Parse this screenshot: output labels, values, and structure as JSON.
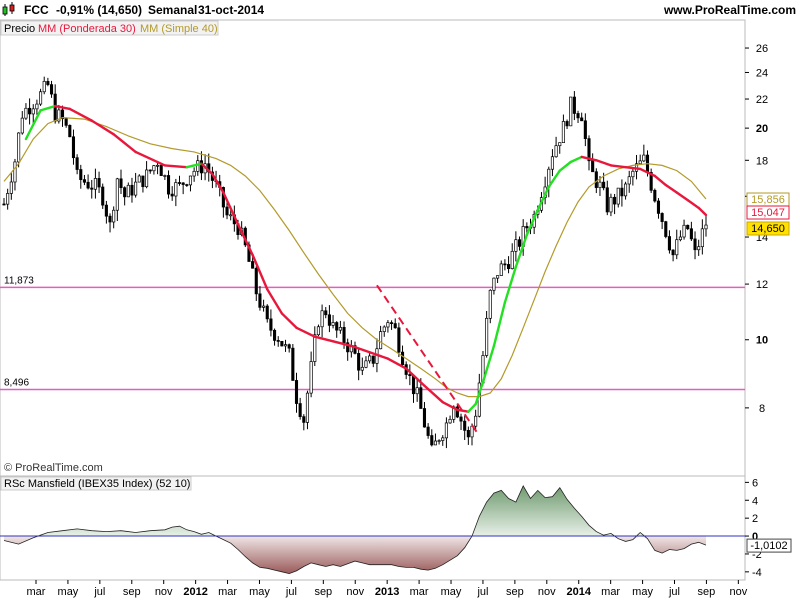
{
  "header": {
    "symbol": "FCC",
    "change": "-0,91% (14,650)",
    "period": "Semanal",
    "date": "31-oct-2014",
    "site": "www.ProRealTime.com"
  },
  "legend": {
    "price": "Precio",
    "wma": "MM (Ponderada 30)",
    "sma": "MM (Simple 40)"
  },
  "copyright": "© ProRealTime.com",
  "colors": {
    "wma": "#e8173c",
    "sma": "#b39a2a",
    "green": "#22e022",
    "hline": "#e060c0",
    "trend": "#e8173c",
    "area_pos": "#8ab08a",
    "area_neg": "#b07070",
    "baseline": "#3030c0",
    "candle": "#000000"
  },
  "chart_data": [
    {
      "type": "candlestick",
      "title": "FCC Semanal",
      "ylim": [
        6.4,
        28.5
      ],
      "y_scale": "log",
      "y_ticks": [
        8,
        10,
        12,
        14,
        16,
        18,
        20,
        22,
        24,
        26
      ],
      "x_ticks": [
        "mar",
        "may",
        "jul",
        "sep",
        "nov",
        "2012",
        "mar",
        "may",
        "jul",
        "sep",
        "nov",
        "2013",
        "mar",
        "may",
        "jul",
        "sep",
        "nov",
        "2014",
        "mar",
        "may",
        "jul",
        "sep",
        "nov"
      ],
      "close_path": [
        [
          0,
          15.6
        ],
        [
          3,
          18
        ],
        [
          5,
          21
        ],
        [
          8,
          21.8
        ],
        [
          10,
          22.3
        ],
        [
          12,
          23
        ],
        [
          14,
          21
        ],
        [
          16,
          20.5
        ],
        [
          18,
          19.5
        ],
        [
          20,
          17
        ],
        [
          22,
          16.8
        ],
        [
          25,
          16.5
        ],
        [
          27,
          16
        ],
        [
          29,
          14.5
        ],
        [
          31,
          17
        ],
        [
          33,
          16
        ],
        [
          36,
          16.6
        ],
        [
          39,
          17.1
        ],
        [
          42,
          18
        ],
        [
          45,
          16.5
        ],
        [
          48,
          16.5
        ],
        [
          51,
          17.3
        ],
        [
          55,
          17.8
        ],
        [
          58,
          16.5
        ],
        [
          61,
          15
        ],
        [
          64,
          14.5
        ],
        [
          66,
          13.5
        ],
        [
          69,
          11.7
        ],
        [
          72,
          10.5
        ],
        [
          75,
          10.1
        ],
        [
          78,
          9.5
        ],
        [
          80,
          8.3
        ],
        [
          82,
          7.7
        ],
        [
          84,
          9.1
        ],
        [
          86,
          10.7
        ],
        [
          88,
          11
        ],
        [
          90,
          10.4
        ],
        [
          93,
          10
        ],
        [
          96,
          9.5
        ],
        [
          98,
          9
        ],
        [
          101,
          9.4
        ],
        [
          103,
          10.2
        ],
        [
          105,
          10.7
        ],
        [
          107,
          10.3
        ],
        [
          109,
          9.5
        ],
        [
          111,
          8.8
        ],
        [
          113,
          8.3
        ],
        [
          115,
          7.6
        ],
        [
          117,
          6.9
        ],
        [
          119,
          7.3
        ],
        [
          121,
          7.6
        ],
        [
          123,
          8.2
        ],
        [
          125,
          7.7
        ],
        [
          127,
          7.2
        ],
        [
          129,
          7.9
        ],
        [
          131,
          9.5
        ],
        [
          133,
          11.6
        ],
        [
          135,
          12.5
        ],
        [
          137,
          12.8
        ],
        [
          139,
          13.2
        ],
        [
          141,
          13.8
        ],
        [
          143,
          14.5
        ],
        [
          145,
          15
        ],
        [
          148,
          17
        ],
        [
          150,
          18.5
        ],
        [
          153,
          20
        ],
        [
          155,
          21.5
        ],
        [
          158,
          21
        ],
        [
          160,
          17.5
        ],
        [
          163,
          16.5
        ],
        [
          165,
          15.5
        ],
        [
          168,
          16
        ],
        [
          170,
          16.4
        ],
        [
          172,
          17.3
        ],
        [
          175,
          18
        ],
        [
          178,
          16
        ],
        [
          181,
          14.3
        ],
        [
          183,
          13.2
        ],
        [
          185,
          14
        ],
        [
          187,
          14.4
        ],
        [
          189,
          13.2
        ],
        [
          192,
          14.65
        ]
      ],
      "series": [
        {
          "name": "MM (Ponderada 30)",
          "last": 15.047,
          "points": [
            [
              6,
              19.3
            ],
            [
              10,
              21.2
            ],
            [
              14,
              21.5
            ],
            [
              18,
              21.3
            ],
            [
              24,
              20.5
            ],
            [
              30,
              19.6
            ],
            [
              36,
              18.5
            ],
            [
              44,
              17.7
            ],
            [
              50,
              17.6
            ],
            [
              54,
              17.8
            ],
            [
              57,
              17.2
            ],
            [
              60,
              16.2
            ],
            [
              64,
              14.6
            ],
            [
              68,
              13.2
            ],
            [
              72,
              11.8
            ],
            [
              76,
              10.9
            ],
            [
              80,
              10.4
            ],
            [
              85,
              10.1
            ],
            [
              90,
              9.95
            ],
            [
              95,
              9.8
            ],
            [
              100,
              9.6
            ],
            [
              105,
              9.4
            ],
            [
              110,
              9.1
            ],
            [
              115,
              8.6
            ],
            [
              120,
              8.15
            ],
            [
              124,
              7.95
            ],
            [
              127,
              7.9
            ],
            [
              129,
              8.1
            ],
            [
              131,
              8.7
            ],
            [
              134,
              9.8
            ],
            [
              137,
              11.3
            ],
            [
              140,
              12.7
            ],
            [
              143,
              14.1
            ],
            [
              146,
              15.3
            ],
            [
              149,
              16.5
            ],
            [
              152,
              17.4
            ],
            [
              155,
              17.9
            ],
            [
              158,
              18.2
            ],
            [
              162,
              18
            ],
            [
              166,
              17.7
            ],
            [
              170,
              17.6
            ],
            [
              174,
              17.5
            ],
            [
              178,
              17.1
            ],
            [
              181,
              16.6
            ],
            [
              184,
              16.2
            ],
            [
              187,
              15.8
            ],
            [
              190,
              15.4
            ],
            [
              192,
              15.047
            ]
          ]
        },
        {
          "name": "MM (Simple 40)",
          "last": 15.856,
          "points": [
            [
              0,
              16.8
            ],
            [
              4,
              17.8
            ],
            [
              8,
              19.3
            ],
            [
              12,
              20.3
            ],
            [
              16,
              20.7
            ],
            [
              22,
              20.6
            ],
            [
              28,
              20.1
            ],
            [
              34,
              19.5
            ],
            [
              40,
              19
            ],
            [
              46,
              18.7
            ],
            [
              52,
              18.5
            ],
            [
              58,
              18.1
            ],
            [
              62,
              17.7
            ],
            [
              66,
              17.1
            ],
            [
              70,
              16.3
            ],
            [
              74,
              15.3
            ],
            [
              78,
              14.3
            ],
            [
              82,
              13.3
            ],
            [
              86,
              12.4
            ],
            [
              90,
              11.6
            ],
            [
              94,
              10.9
            ],
            [
              98,
              10.4
            ],
            [
              102,
              10
            ],
            [
              106,
              9.7
            ],
            [
              110,
              9.4
            ],
            [
              114,
              9.1
            ],
            [
              118,
              8.8
            ],
            [
              121,
              8.55
            ],
            [
              124,
              8.4
            ],
            [
              127,
              8.3
            ],
            [
              130,
              8.3
            ],
            [
              133,
              8.4
            ],
            [
              136,
              8.8
            ],
            [
              139,
              9.5
            ],
            [
              142,
              10.4
            ],
            [
              145,
              11.4
            ],
            [
              148,
              12.5
            ],
            [
              151,
              13.6
            ],
            [
              154,
              14.7
            ],
            [
              157,
              15.7
            ],
            [
              160,
              16.5
            ],
            [
              164,
              17.1
            ],
            [
              168,
              17.5
            ],
            [
              172,
              17.7
            ],
            [
              176,
              17.8
            ],
            [
              180,
              17.7
            ],
            [
              184,
              17.4
            ],
            [
              188,
              16.8
            ],
            [
              192,
              15.856
            ]
          ]
        }
      ],
      "horizontal_lines": [
        {
          "value": 11.873,
          "label": "11,873"
        },
        {
          "value": 8.496,
          "label": "8,496"
        }
      ],
      "trendline": [
        [
          102,
          11.95
        ],
        [
          130,
          7.3
        ]
      ],
      "last_labels": [
        "15,856",
        "15,047",
        "14,650"
      ]
    },
    {
      "type": "area",
      "title": "RSc Mansfield (IBEX35 Index) (52 10)",
      "ylim": [
        -4.8,
        6.6
      ],
      "y_ticks": [
        6,
        4,
        2,
        0,
        -2,
        -4
      ],
      "last_value": -1.0102,
      "last_label": "-1,0102",
      "points": [
        [
          0,
          -0.5
        ],
        [
          4,
          -0.9
        ],
        [
          8,
          -0.2
        ],
        [
          12,
          0.4
        ],
        [
          16,
          0.6
        ],
        [
          20,
          0.8
        ],
        [
          24,
          0.6
        ],
        [
          28,
          0.5
        ],
        [
          32,
          0.6
        ],
        [
          36,
          0.4
        ],
        [
          40,
          0.6
        ],
        [
          44,
          0.7
        ],
        [
          46,
          1
        ],
        [
          48,
          1.1
        ],
        [
          50,
          0.7
        ],
        [
          52,
          0.5
        ],
        [
          54,
          0.2
        ],
        [
          56,
          0.4
        ],
        [
          58,
          0
        ],
        [
          60,
          -0.4
        ],
        [
          62,
          -0.8
        ],
        [
          64,
          -1.5
        ],
        [
          66,
          -2.3
        ],
        [
          68,
          -3
        ],
        [
          70,
          -3.5
        ],
        [
          72,
          -3.6
        ],
        [
          74,
          -3.8
        ],
        [
          76,
          -4
        ],
        [
          78,
          -4.2
        ],
        [
          80,
          -3.9
        ],
        [
          82,
          -3.4
        ],
        [
          84,
          -3
        ],
        [
          86,
          -3.2
        ],
        [
          88,
          -3.4
        ],
        [
          90,
          -3.2
        ],
        [
          92,
          -3.4
        ],
        [
          94,
          -3.1
        ],
        [
          96,
          -2.8
        ],
        [
          98,
          -3
        ],
        [
          100,
          -3.2
        ],
        [
          102,
          -3.2
        ],
        [
          104,
          -3.2
        ],
        [
          106,
          -3.2
        ],
        [
          108,
          -3.4
        ],
        [
          110,
          -3.5
        ],
        [
          112,
          -3.5
        ],
        [
          114,
          -3.7
        ],
        [
          116,
          -3.8
        ],
        [
          118,
          -3.6
        ],
        [
          120,
          -3.2
        ],
        [
          122,
          -2.7
        ],
        [
          124,
          -2.2
        ],
        [
          126,
          -1.3
        ],
        [
          128,
          0
        ],
        [
          130,
          2.2
        ],
        [
          132,
          3.8
        ],
        [
          134,
          4.8
        ],
        [
          136,
          5.1
        ],
        [
          138,
          4.2
        ],
        [
          140,
          3.8
        ],
        [
          142,
          5.6
        ],
        [
          144,
          4.2
        ],
        [
          146,
          5.1
        ],
        [
          148,
          4.3
        ],
        [
          150,
          4.4
        ],
        [
          152,
          5.4
        ],
        [
          154,
          4.1
        ],
        [
          156,
          3.1
        ],
        [
          158,
          2.2
        ],
        [
          160,
          1.2
        ],
        [
          162,
          0.5
        ],
        [
          164,
          0.1
        ],
        [
          166,
          0.3
        ],
        [
          168,
          -0.3
        ],
        [
          170,
          -0.6
        ],
        [
          172,
          -0.4
        ],
        [
          174,
          0.4
        ],
        [
          176,
          -0.3
        ],
        [
          178,
          -1.6
        ],
        [
          180,
          -1.9
        ],
        [
          182,
          -1.5
        ],
        [
          184,
          -1.6
        ],
        [
          186,
          -1.4
        ],
        [
          188,
          -0.9
        ],
        [
          190,
          -0.7
        ],
        [
          192,
          -1.0102
        ]
      ]
    }
  ]
}
